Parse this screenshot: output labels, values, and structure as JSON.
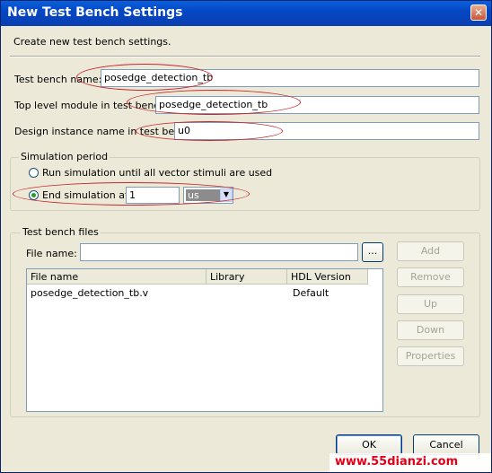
{
  "window": {
    "title": "New Test Bench Settings"
  },
  "intro": "Create new test bench settings.",
  "fields": {
    "bench_name": {
      "label": "Test bench name:",
      "value": "posedge_detection_tb"
    },
    "top_module": {
      "label": "Top level module in test bench:",
      "value": "posedge_detection_tb"
    },
    "instance": {
      "label": "Design instance name in test bench:",
      "value": "u0"
    }
  },
  "sim": {
    "group_title": "Simulation period",
    "run_until_label": "Run simulation until all vector stimuli are used",
    "end_label": "End simulation at:",
    "end_value": "1",
    "unit_value": "us"
  },
  "files": {
    "group_title": "Test bench files",
    "file_name_label": "File name:",
    "file_name_value": "",
    "browse_label": "...",
    "columns": [
      "File name",
      "Library",
      "HDL Version"
    ],
    "rows": [
      {
        "name": "posedge_detection_tb.v",
        "library": "",
        "hdl": "Default"
      }
    ],
    "buttons": {
      "add": "Add",
      "remove": "Remove",
      "up": "Up",
      "down": "Down",
      "properties": "Properties"
    }
  },
  "footer": {
    "ok": "OK",
    "cancel": "Cancel",
    "watermark": "www.55dianzi.com"
  },
  "colors": {
    "titlebar": "#0447c4",
    "annotation": "#c8282d",
    "watermark": "#e0001a"
  }
}
